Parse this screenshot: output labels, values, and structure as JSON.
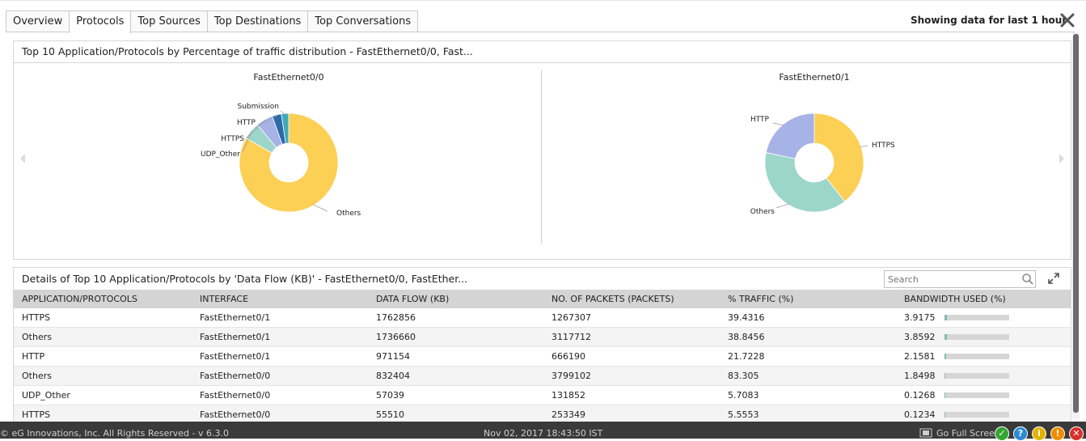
{
  "tabs": [
    {
      "label": "Overview",
      "active": false
    },
    {
      "label": "Protocols",
      "active": true
    },
    {
      "label": "Top Sources",
      "active": false
    },
    {
      "label": "Top Destinations",
      "active": false
    },
    {
      "label": "Top Conversations",
      "active": false
    }
  ],
  "header": {
    "showing_text": "Showing data for last 1 hour",
    "close_icon": "close-icon"
  },
  "chart_panel": {
    "title": "Top 10 Application/Protocols by Percentage of traffic distribution - FastEthernet0/0, Fast..."
  },
  "chart_data": [
    {
      "type": "pie",
      "title": "FastEthernet0/0",
      "labels": [
        "Others",
        "UDP_Other",
        "HTTPS",
        "HTTP",
        "Submission"
      ],
      "values": [
        83.305,
        5.7083,
        5.5553,
        3.0,
        2.4
      ],
      "colors": [
        "#fccf55",
        "#9bd6c9",
        "#a7b2e7",
        "#2c6aa8",
        "#41aab9"
      ],
      "donut": true
    },
    {
      "type": "pie",
      "title": "FastEthernet0/1",
      "labels": [
        "HTTPS",
        "Others",
        "HTTP"
      ],
      "values": [
        39.4316,
        38.8456,
        21.7228
      ],
      "colors": [
        "#fccf55",
        "#9bd6c9",
        "#a7b2e7"
      ],
      "donut": true
    }
  ],
  "details": {
    "title": "Details of Top 10 Application/Protocols by 'Data Flow (KB)' - FastEthernet0/0, FastEther...",
    "search_placeholder": "Search",
    "columns": [
      "APPLICATION/PROTOCOLS",
      "INTERFACE",
      "DATA FLOW (KB)",
      "NO. OF PACKETS (PACKETS)",
      "% TRAFFIC (%)",
      "BANDWIDTH USED (%)"
    ],
    "rows": [
      {
        "app": "HTTPS",
        "iface": "FastEthernet0/1",
        "flow": "1762856",
        "packets": "1267307",
        "traffic": "39.4316",
        "bw": "3.9175",
        "bw_fraction": 0.039
      },
      {
        "app": "Others",
        "iface": "FastEthernet0/1",
        "flow": "1736660",
        "packets": "3117712",
        "traffic": "38.8456",
        "bw": "3.8592",
        "bw_fraction": 0.039
      },
      {
        "app": "HTTP",
        "iface": "FastEthernet0/1",
        "flow": "971154",
        "packets": "666190",
        "traffic": "21.7228",
        "bw": "2.1581",
        "bw_fraction": 0.022
      },
      {
        "app": "Others",
        "iface": "FastEthernet0/0",
        "flow": "832404",
        "packets": "3799102",
        "traffic": "83.305",
        "bw": "1.8498",
        "bw_fraction": 0.018
      },
      {
        "app": "UDP_Other",
        "iface": "FastEthernet0/0",
        "flow": "57039",
        "packets": "131852",
        "traffic": "5.7083",
        "bw": "0.1268",
        "bw_fraction": 0.0013
      },
      {
        "app": "HTTPS",
        "iface": "FastEthernet0/0",
        "flow": "55510",
        "packets": "253349",
        "traffic": "5.5553",
        "bw": "0.1234",
        "bw_fraction": 0.0012
      }
    ]
  },
  "footer": {
    "copyright": "© eG Innovations, Inc. All Rights Reserved - v 6.3.0",
    "datetime": "Nov 02, 2017 18:43:50 IST",
    "fullscreen_label": "Go Full Screen",
    "status_icons": [
      {
        "name": "ok-status-icon",
        "glyph": "✓",
        "color": "#33a532"
      },
      {
        "name": "help-status-icon",
        "glyph": "?",
        "color": "#2a8ad6"
      },
      {
        "name": "info-status-icon",
        "glyph": "i",
        "color": "#e0b400"
      },
      {
        "name": "warning-status-icon",
        "glyph": "!",
        "color": "#f08b00"
      },
      {
        "name": "critical-status-icon",
        "glyph": "✕",
        "color": "#d9302a"
      }
    ]
  }
}
